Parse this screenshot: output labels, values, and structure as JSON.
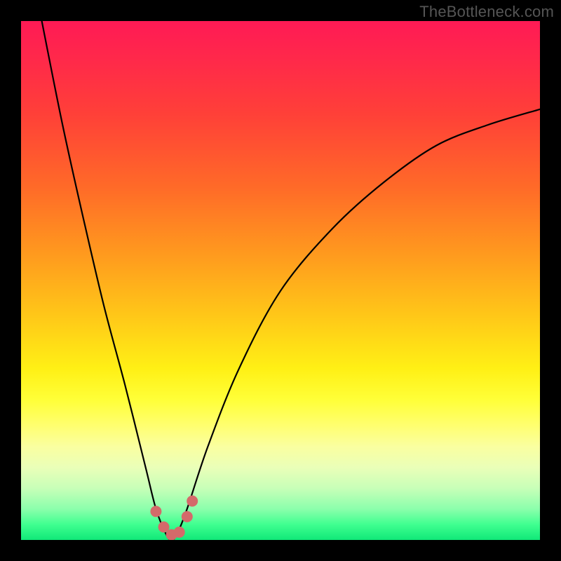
{
  "watermark": "TheBottleneck.com",
  "colors": {
    "frame": "#000000",
    "gradient_top": "#ff1a55",
    "gradient_mid": "#ffff38",
    "gradient_bottom": "#10e878",
    "curve": "#000000",
    "markers": "#d46a6a"
  },
  "chart_data": {
    "type": "line",
    "title": "",
    "xlabel": "",
    "ylabel": "",
    "xlim": [
      0,
      100
    ],
    "ylim": [
      0,
      100
    ],
    "grid": false,
    "note": "V-shaped bottleneck curve; y ≈ mismatch %, minimum ≈ 0 near x≈29. No numeric tick labels are visible in the image — values below are estimated from pixel positions.",
    "series": [
      {
        "name": "bottleneck-curve",
        "x": [
          4,
          8,
          12,
          16,
          20,
          24,
          26,
          28,
          29,
          30,
          32,
          36,
          42,
          50,
          60,
          70,
          80,
          90,
          100
        ],
        "y": [
          100,
          80,
          62,
          45,
          30,
          14,
          6,
          1,
          0,
          1,
          6,
          18,
          33,
          48,
          60,
          69,
          76,
          80,
          83
        ]
      }
    ],
    "markers": {
      "name": "minimum-cluster",
      "points": [
        {
          "x": 26.0,
          "y": 5.5
        },
        {
          "x": 27.5,
          "y": 2.5
        },
        {
          "x": 29.0,
          "y": 1.0
        },
        {
          "x": 30.5,
          "y": 1.5
        },
        {
          "x": 32.0,
          "y": 4.5
        },
        {
          "x": 33.0,
          "y": 7.5
        }
      ]
    }
  }
}
